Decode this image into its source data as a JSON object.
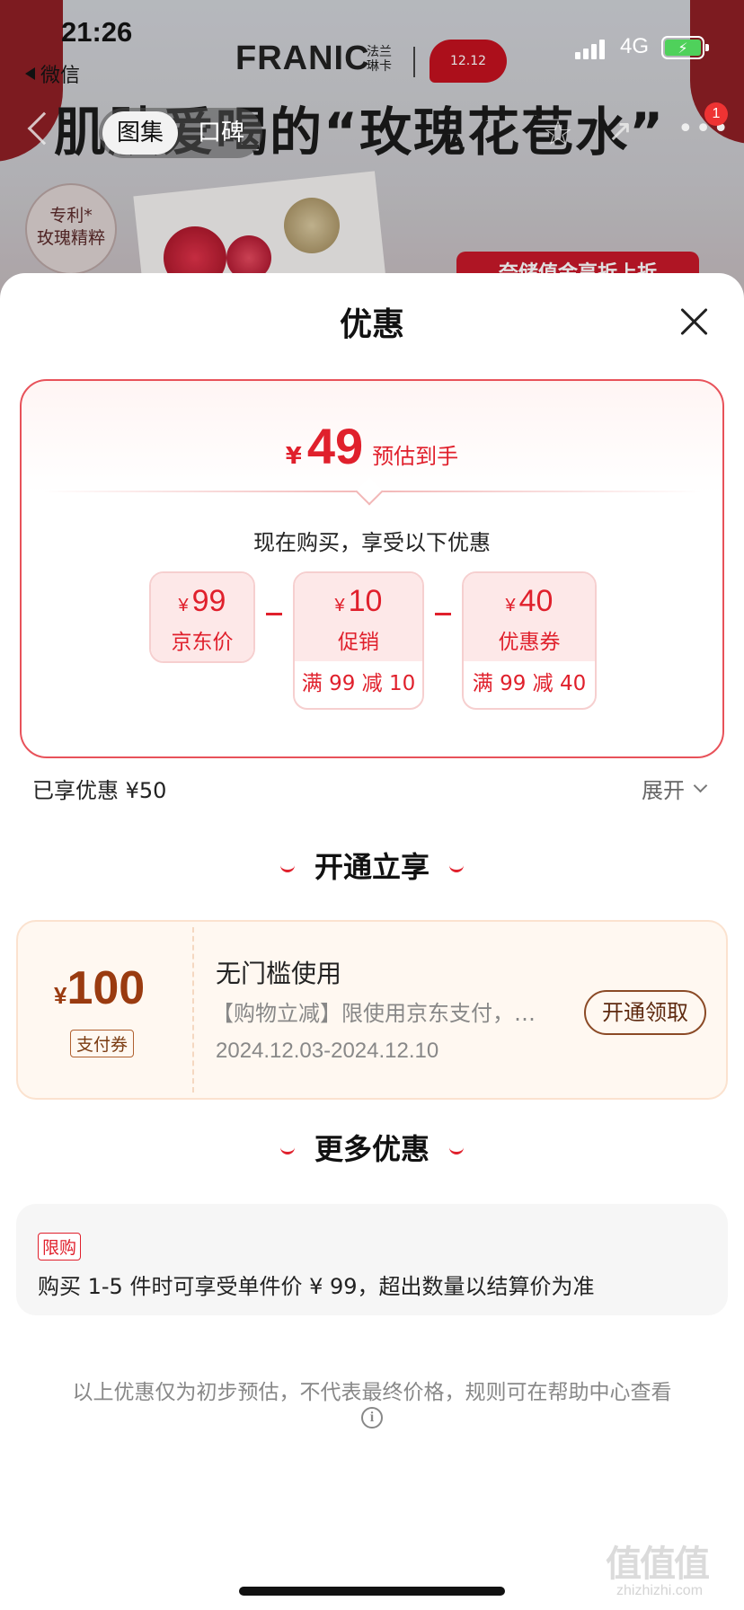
{
  "status_bar": {
    "time": "21:26",
    "back_app": "微信",
    "network": "4G"
  },
  "product_page": {
    "brand": "FRANIC",
    "brand_cn": "法兰琳卡",
    "promo_badge": "12.12",
    "hero_title": "肌肤爱喝的“玫瑰花苞水”",
    "tabs": [
      "图集",
      "口碑"
    ],
    "active_tab": "图集",
    "patent_label": "专利*\n玫瑰精粹",
    "banner_text": "奈储值金享折上折",
    "more_badge_count": "1"
  },
  "sheet": {
    "title": "优惠",
    "final_price": {
      "currency": "¥",
      "amount": "49",
      "label": "预估到手"
    },
    "buy_now_text": "现在购买，享受以下优惠",
    "breakdown": [
      {
        "amount": "99",
        "desc": "京东价",
        "detail": ""
      },
      {
        "amount": "10",
        "desc": "促销",
        "detail": "满 99 减 10"
      },
      {
        "amount": "40",
        "desc": "优惠券",
        "detail": "满 99 减 40"
      }
    ],
    "currency_symbol": "¥",
    "saved_label": "已享优惠 ¥50",
    "expand_label": "展开",
    "section_open": "开通立享",
    "coupon": {
      "currency": "¥",
      "amount": "100",
      "type": "支付券",
      "name": "无门槛使用",
      "desc": "【购物立减】限使用京东支付，…",
      "date": "2024.12.03-2024.12.10",
      "button": "开通领取"
    },
    "section_more": "更多优惠",
    "limit": {
      "tag": "限购",
      "text": "购买 1-5 件时可享受单件价 ¥ 99，超出数量以结算价为准"
    },
    "disclaimer": "以上优惠仅为初步预估，不代表最终价格，规则可在帮助中心查看"
  },
  "watermark": {
    "text": "值值值",
    "url": "zhizhizhi.com"
  },
  "colors": {
    "accent": "#e0202c",
    "coupon_brown": "#9a3b10",
    "coupon_bg": "#fff8f1"
  },
  "icons": [
    "back-arrow-icon",
    "star-icon",
    "share-icon",
    "more-icon",
    "close-icon",
    "chevron-down-icon",
    "info-icon",
    "battery-icon",
    "signal-icon"
  ]
}
